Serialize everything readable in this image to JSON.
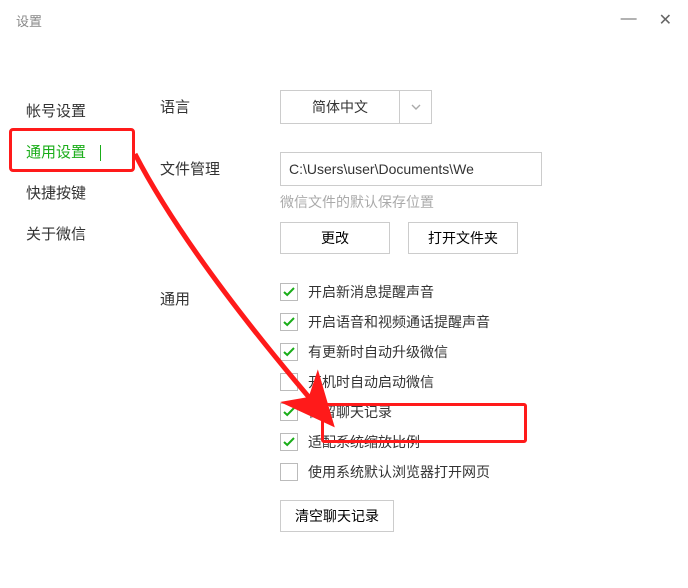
{
  "window": {
    "title": "设置"
  },
  "sidebar": {
    "items": [
      {
        "label": "帐号设置",
        "active": false
      },
      {
        "label": "通用设置",
        "active": true
      },
      {
        "label": "快捷按键",
        "active": false
      },
      {
        "label": "关于微信",
        "active": false
      }
    ]
  },
  "sections": {
    "language": {
      "label": "语言",
      "value": "简体中文"
    },
    "fileManagement": {
      "label": "文件管理",
      "path": "C:\\Users\\user\\Documents\\We",
      "hint": "微信文件的默认保存位置",
      "changeBtn": "更改",
      "openFolderBtn": "打开文件夹"
    },
    "general": {
      "label": "通用",
      "checks": [
        {
          "label": "开启新消息提醒声音",
          "checked": true
        },
        {
          "label": "开启语音和视频通话提醒声音",
          "checked": true
        },
        {
          "label": "有更新时自动升级微信",
          "checked": true
        },
        {
          "label": "开机时自动启动微信",
          "checked": false
        },
        {
          "label": "保留聊天记录",
          "checked": true
        },
        {
          "label": "适配系统缩放比例",
          "checked": true
        },
        {
          "label": "使用系统默认浏览器打开网页",
          "checked": false
        }
      ],
      "clearBtn": "清空聊天记录"
    }
  }
}
